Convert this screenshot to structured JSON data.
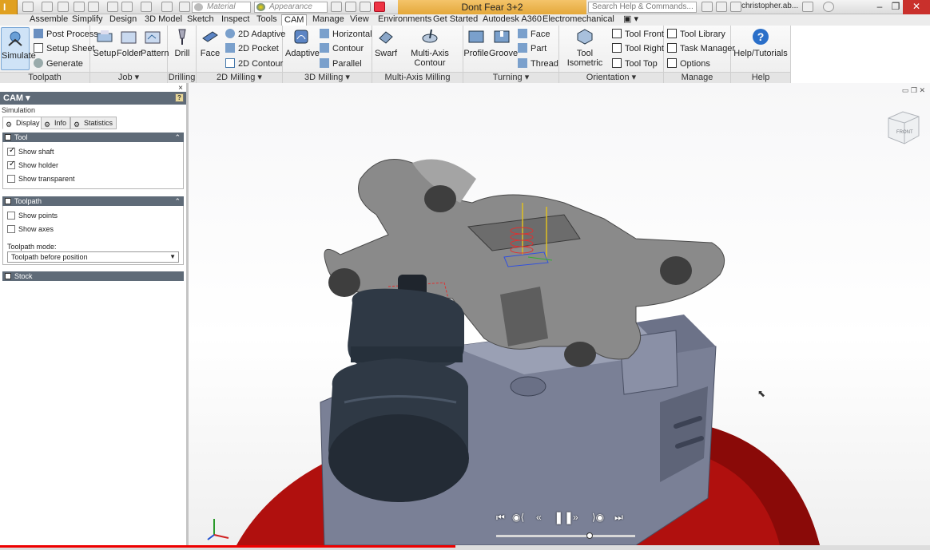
{
  "titlebar": {
    "material_placeholder": "Material",
    "appearance_placeholder": "Appearance",
    "document_title": "Dont Fear 3+2",
    "search_placeholder": "Search Help & Commands...",
    "user_name": "christopher.ab..."
  },
  "ribbon_tabs": [
    "Assemble",
    "Simplify",
    "Design",
    "3D Model",
    "Sketch",
    "Inspect",
    "Tools",
    "CAM",
    "Manage",
    "View",
    "Environments",
    "Get Started",
    "Autodesk A360",
    "Electromechanical"
  ],
  "active_tab": "CAM",
  "ribbon": {
    "toolpath": {
      "title": "Toolpath",
      "simulate": "Simulate",
      "post_process": "Post Process",
      "setup_sheet": "Setup Sheet",
      "generate": "Generate"
    },
    "job": {
      "title": "Job",
      "setup": "Setup",
      "folder": "Folder",
      "pattern": "Pattern"
    },
    "drilling": {
      "title": "Drilling",
      "drill": "Drill"
    },
    "milling_2d": {
      "title": "2D Milling",
      "face": "Face",
      "adaptive_2d": "2D Adaptive",
      "pocket_2d": "2D Pocket",
      "contour_2d": "2D Contour"
    },
    "milling_3d": {
      "title": "3D Milling",
      "adaptive": "Adaptive",
      "horizontal": "Horizontal",
      "contour": "Contour",
      "parallel": "Parallel"
    },
    "multi_axis": {
      "title": "Multi-Axis Milling",
      "swarf": "Swarf",
      "multi_axis_contour": "Multi-Axis Contour"
    },
    "turning": {
      "title": "Turning",
      "profile": "Profile",
      "groove": "Groove",
      "face": "Face",
      "part": "Part",
      "thread": "Thread"
    },
    "orientation": {
      "title": "Orientation",
      "tool_isometric": "Tool Isometric",
      "tool_front": "Tool Front",
      "tool_right": "Tool Right",
      "tool_top": "Tool Top"
    },
    "manage": {
      "title": "Manage",
      "tool_library": "Tool Library",
      "task_manager": "Task Manager",
      "options": "Options"
    },
    "help": {
      "title": "Help",
      "help_tutorials": "Help/Tutorials"
    }
  },
  "panel": {
    "header": "CAM ▾",
    "help_glyph": "?",
    "subtitle": "Simulation",
    "tabs": [
      "Display",
      "Info",
      "Statistics"
    ],
    "tool_section": {
      "title": "Tool",
      "options": [
        {
          "label": "Show shaft",
          "checked": true
        },
        {
          "label": "Show holder",
          "checked": true
        },
        {
          "label": "Show transparent",
          "checked": false
        }
      ]
    },
    "toolpath_section": {
      "title": "Toolpath",
      "options": [
        {
          "label": "Show points",
          "checked": false
        },
        {
          "label": "Show axes",
          "checked": false
        }
      ],
      "mode_label": "Toolpath mode:",
      "mode_value": "Toolpath before position"
    },
    "stock_section": {
      "title": "Stock"
    }
  },
  "viewcube": {
    "label": "FRONT"
  },
  "playback": {
    "buttons": [
      "to-start",
      "prev-marker",
      "rewind",
      "pause",
      "fast-forward",
      "next-marker",
      "to-end"
    ],
    "position": 0.68
  },
  "video_progress": 0.49,
  "colors": {
    "accent": "#e4a83a",
    "panel_header": "#5f6b78",
    "part_grey": "#8a8a8a",
    "fixture_blue": "#7a8096",
    "table_red": "#b0100e",
    "holder_dark": "#2f3945"
  }
}
